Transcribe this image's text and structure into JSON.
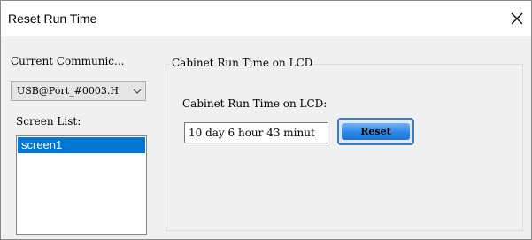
{
  "window": {
    "title": "Reset Run Time",
    "close_icon": "close-icon"
  },
  "left": {
    "current_label": "Current Communic...",
    "current_value": "USB@Port_#0003.H",
    "screen_list_label": "Screen List:",
    "screens": [
      "screen1"
    ]
  },
  "group": {
    "legend": "Cabinet Run Time on LCD",
    "field_label": "Cabinet Run Time on LCD:",
    "runtime_value": "10 day 6 hour 43 minut",
    "reset_label": "Reset"
  },
  "colors": {
    "selection": "#0078d7",
    "reset_button": "#2a88e8"
  }
}
